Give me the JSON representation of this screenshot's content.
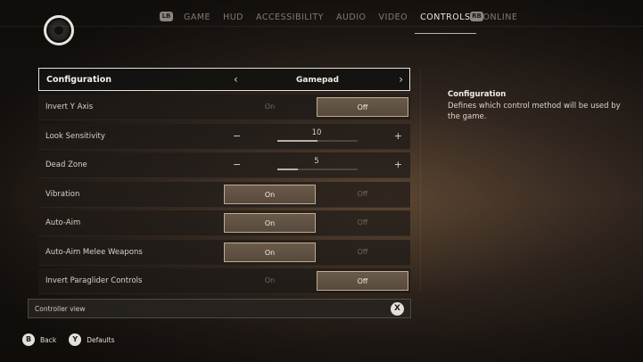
{
  "topbar": {
    "left_bumper": "LB",
    "right_bumper": "RB",
    "tabs": [
      {
        "label": "GAME",
        "active": false
      },
      {
        "label": "HUD",
        "active": false
      },
      {
        "label": "ACCESSIBILITY",
        "active": false
      },
      {
        "label": "AUDIO",
        "active": false
      },
      {
        "label": "VIDEO",
        "active": false
      },
      {
        "label": "CONTROLS",
        "active": true
      },
      {
        "label": "ONLINE",
        "active": false
      }
    ]
  },
  "settings": {
    "configuration": {
      "label": "Configuration",
      "value": "Gamepad"
    },
    "invert_y": {
      "label": "Invert Y Axis",
      "on": "On",
      "off": "Off",
      "selected": "Off"
    },
    "look_sensitivity": {
      "label": "Look Sensitivity",
      "value": "10",
      "fraction": 0.5,
      "minus": "−",
      "plus": "+"
    },
    "dead_zone": {
      "label": "Dead Zone",
      "value": "5",
      "fraction": 0.25,
      "minus": "−",
      "plus": "+"
    },
    "vibration": {
      "label": "Vibration",
      "on": "On",
      "off": "Off",
      "selected": "On"
    },
    "auto_aim": {
      "label": "Auto-Aim",
      "on": "On",
      "off": "Off",
      "selected": "On"
    },
    "auto_aim_melee": {
      "label": "Auto-Aim Melee Weapons",
      "on": "On",
      "off": "Off",
      "selected": "On"
    },
    "invert_paraglider": {
      "label": "Invert Paraglider Controls",
      "on": "On",
      "off": "Off",
      "selected": "Off"
    }
  },
  "controller_view": {
    "label": "Controller view",
    "button": "X"
  },
  "hints": [
    {
      "button": "B",
      "label": "Back"
    },
    {
      "button": "Y",
      "label": "Defaults"
    }
  ],
  "description": {
    "title": "Configuration",
    "body": "Defines which control method will be used by the game."
  },
  "colors": {
    "accent_border": "#c4ab8e",
    "active_fill": "#5f5043",
    "text": "#d9d2c7"
  }
}
